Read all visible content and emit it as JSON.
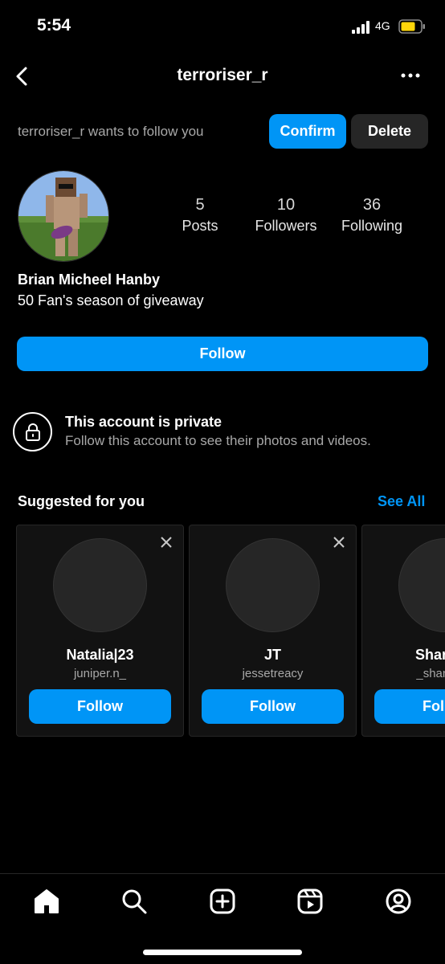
{
  "status_bar": {
    "time": "5:54",
    "network": "4G"
  },
  "header": {
    "title": "terroriser_r"
  },
  "follow_request": {
    "text": "terroriser_r wants to follow you",
    "confirm_label": "Confirm",
    "delete_label": "Delete"
  },
  "profile": {
    "stats": [
      {
        "value": "5",
        "label": "Posts"
      },
      {
        "value": "10",
        "label": "Followers"
      },
      {
        "value": "36",
        "label": "Following"
      }
    ],
    "full_name": "Brian Micheel Hanby",
    "bio": "50 Fan's season of giveaway",
    "follow_label": "Follow"
  },
  "private": {
    "title": "This account is private",
    "description": "Follow this account to see their photos and videos."
  },
  "suggested": {
    "title": "Suggested for you",
    "see_all_label": "See All",
    "cards": [
      {
        "name": "Natalia|23",
        "username": "juniper.n_",
        "follow_label": "Follow"
      },
      {
        "name": "JT",
        "username": "jessetreacy",
        "follow_label": "Follow"
      },
      {
        "name": "Shannon",
        "username": "_shannon_",
        "follow_label": "Follow"
      }
    ]
  },
  "nav": {
    "items": [
      "home-icon",
      "search-icon",
      "create-icon",
      "reels-icon",
      "profile-icon"
    ]
  },
  "colors": {
    "accent": "#0095f6",
    "background": "#000000",
    "secondary_button": "#262626",
    "muted_text": "#a8a8a8",
    "battery": "#ffd60a"
  }
}
